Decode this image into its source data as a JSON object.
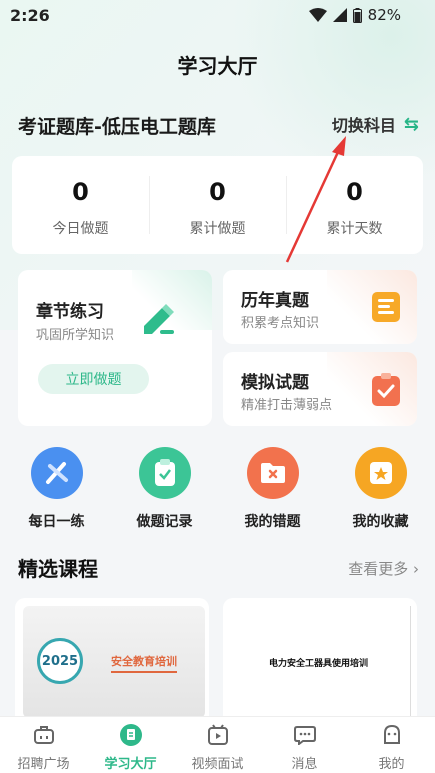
{
  "status_bar": {
    "time": "2:26",
    "battery": "82%"
  },
  "header": {
    "title": "学习大厅"
  },
  "bank": {
    "title": "考证题库-低压电工题库",
    "switch_label": "切换科目"
  },
  "stats": [
    {
      "value": "0",
      "label": "今日做题"
    },
    {
      "value": "0",
      "label": "累计做题"
    },
    {
      "value": "0",
      "label": "累计天数"
    }
  ],
  "chapter": {
    "title": "章节练习",
    "subtitle": "巩固所学知识",
    "button": "立即做题"
  },
  "history": {
    "title": "历年真题",
    "subtitle": "积累考点知识"
  },
  "mock": {
    "title": "模拟试题",
    "subtitle": "精准打击薄弱点"
  },
  "quick_links": [
    {
      "label": "每日一练",
      "icon": "daily-practice-icon",
      "color": "#4a90f0"
    },
    {
      "label": "做题记录",
      "icon": "record-icon",
      "color": "#3cc596"
    },
    {
      "label": "我的错题",
      "icon": "wrong-questions-icon",
      "color": "#f2724d"
    },
    {
      "label": "我的收藏",
      "icon": "favorites-icon",
      "color": "#f6a623"
    }
  ],
  "courses_section": {
    "title": "精选课程",
    "more": "查看更多"
  },
  "courses": [
    {
      "year": "2025",
      "name": "安全教育培训"
    },
    {
      "name": "电力安全工器具使用培训"
    }
  ],
  "tabs": [
    {
      "label": "招聘广场",
      "icon": "briefcase-icon"
    },
    {
      "label": "学习大厅",
      "icon": "study-icon",
      "active": true
    },
    {
      "label": "视频面试",
      "icon": "video-icon"
    },
    {
      "label": "消息",
      "icon": "message-icon"
    },
    {
      "label": "我的",
      "icon": "profile-icon"
    }
  ],
  "colors": {
    "accent": "#2eb88a",
    "annotation_arrow": "#e53935"
  }
}
